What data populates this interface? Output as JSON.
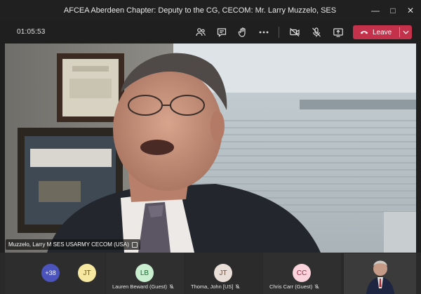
{
  "window": {
    "title": "AFCEA Aberdeen Chapter: Deputy to the CG, CECOM: Mr. Larry Muzzelo, SES",
    "minimize_glyph": "—",
    "maximize_glyph": "□",
    "close_glyph": "✕"
  },
  "toolbar": {
    "timer": "01:05:53",
    "icons": [
      "participants-icon",
      "chat-icon",
      "raise-hand-icon",
      "more-actions-icon",
      "camera-off-icon",
      "mic-off-icon",
      "share-screen-icon"
    ],
    "leave_label": "Leave"
  },
  "main_video": {
    "name_label": "Muzzelo, Larry M SES USARMY CECOM (USA)"
  },
  "participants": {
    "more_count": "+38",
    "items": [
      {
        "initials": "JT",
        "name": "",
        "color": "#f6e7a1",
        "text_color": "#6b5a11"
      },
      {
        "initials": "LB",
        "name": "Lauren Beward (Guest)",
        "color": "#c9efd0",
        "text_color": "#1f6b35"
      },
      {
        "initials": "JT",
        "name": "Thoma, John [US]",
        "color": "#eadfd8",
        "text_color": "#6b4b3a"
      },
      {
        "initials": "CC",
        "name": "Chris Carr (Guest)",
        "color": "#fbd3dc",
        "text_color": "#a4263d"
      }
    ]
  },
  "colors": {
    "leave": "#c4314b",
    "more_badge": "#4b53bc"
  }
}
